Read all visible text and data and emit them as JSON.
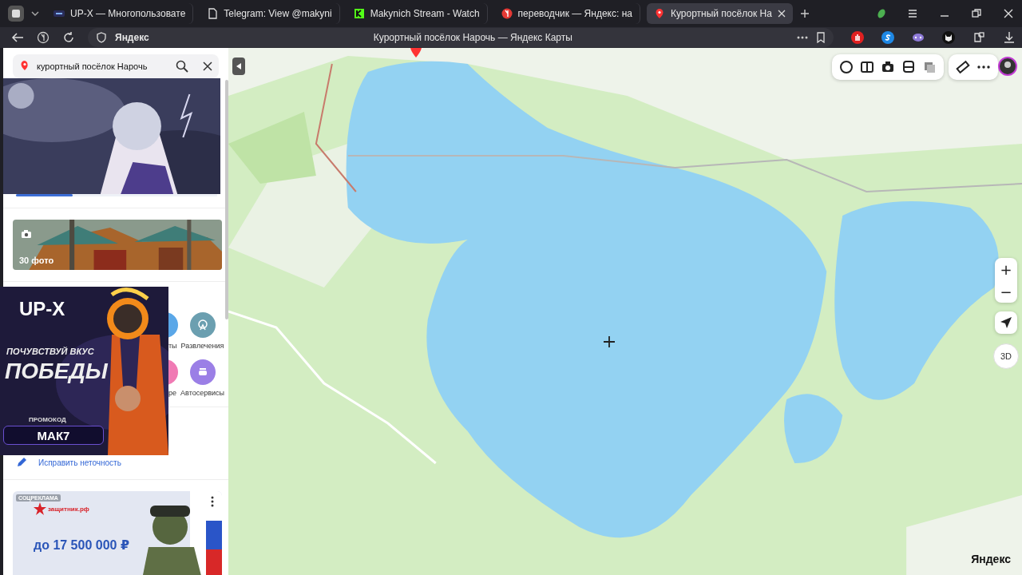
{
  "browser": {
    "tabs": [
      {
        "kind": "upx",
        "label": "UP-X — Многопользовате",
        "selected": false
      },
      {
        "kind": "doc",
        "label": "Telegram: View @makyni",
        "selected": false
      },
      {
        "kind": "kick",
        "label": "Makynich Stream - Watch",
        "selected": false
      },
      {
        "kind": "yandex",
        "label": "переводчик — Яндекс: на",
        "selected": false
      },
      {
        "kind": "maps",
        "label": "Курортный посёлок На",
        "selected": true
      }
    ],
    "address": {
      "site": "Яндекс",
      "page_title": "Курортный посёлок Нарочь — Яндекс Карты"
    }
  },
  "sidebar": {
    "search": {
      "value": "курортный посёлок Нарочь"
    },
    "gallery": {
      "level": 0.28
    },
    "photos": {
      "count_label": "30 фото"
    },
    "categories": [
      {
        "label": "ты",
        "color": "#5aa7e8"
      },
      {
        "label": "Развлечения",
        "color": "#6b9fb0"
      },
      {
        "label": "ре",
        "color": "#f07ab4"
      },
      {
        "label": "Автосервисы",
        "color": "#9b7fe6"
      }
    ],
    "edit_link": "Исправить неточность",
    "social_ad": {
      "tag": "СОЦРЕКЛАМА",
      "brand": "защитник.рф",
      "amount": "до 17 500 000 ₽"
    }
  },
  "promo_overlay": {
    "brand": "UP-X",
    "slogan_1": "ПОЧУВСТВУЙ ВКУС",
    "slogan_2": "ПОБЕДЫ",
    "code_label": "ПРОМОКОД",
    "code": "МАК7"
  },
  "map": {
    "zoom_in": "+",
    "zoom_out": "−",
    "view_3d": "3D",
    "logo": "Яндекс"
  }
}
